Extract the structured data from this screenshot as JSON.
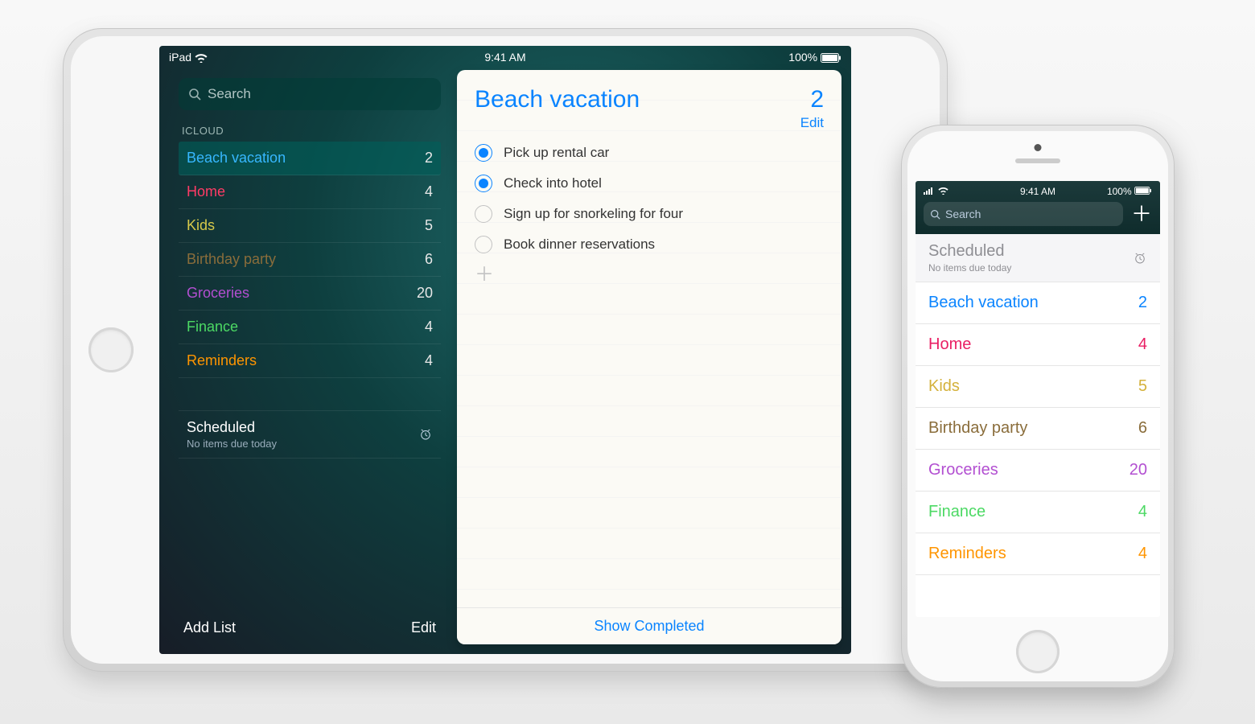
{
  "ipad": {
    "status": {
      "device": "iPad",
      "time": "9:41 AM",
      "battery": "100%"
    },
    "search": {
      "placeholder": "Search"
    },
    "section": "ICLOUD",
    "lists": [
      {
        "name": "Beach vacation",
        "count": "2",
        "color": "#37b7ff",
        "selected": true
      },
      {
        "name": "Home",
        "count": "4",
        "color": "#ff3b66"
      },
      {
        "name": "Kids",
        "count": "5",
        "color": "#d6c94a"
      },
      {
        "name": "Birthday party",
        "count": "6",
        "color": "#8a6d3b"
      },
      {
        "name": "Groceries",
        "count": "20",
        "color": "#b24fd1"
      },
      {
        "name": "Finance",
        "count": "4",
        "color": "#4cd964"
      },
      {
        "name": "Reminders",
        "count": "4",
        "color": "#ff9500"
      }
    ],
    "scheduled": {
      "title": "Scheduled",
      "sub": "No items due today"
    },
    "footer": {
      "add": "Add List",
      "edit": "Edit"
    },
    "detail": {
      "title": "Beach vacation",
      "count": "2",
      "edit": "Edit",
      "items": [
        {
          "text": "Pick up rental car",
          "checked": true
        },
        {
          "text": "Check into hotel",
          "checked": true
        },
        {
          "text": "Sign up for snorkeling for four",
          "checked": false
        },
        {
          "text": "Book dinner reservations",
          "checked": false
        }
      ],
      "showCompleted": "Show Completed"
    }
  },
  "iphone": {
    "status": {
      "time": "9:41 AM",
      "battery": "100%"
    },
    "search": {
      "placeholder": "Search"
    },
    "scheduled": {
      "title": "Scheduled",
      "sub": "No items due today"
    },
    "lists": [
      {
        "name": "Beach vacation",
        "count": "2",
        "color": "#0a84ff"
      },
      {
        "name": "Home",
        "count": "4",
        "color": "#e91e63"
      },
      {
        "name": "Kids",
        "count": "5",
        "color": "#d4b13b"
      },
      {
        "name": "Birthday party",
        "count": "6",
        "color": "#8a6d3b"
      },
      {
        "name": "Groceries",
        "count": "20",
        "color": "#b24fd1"
      },
      {
        "name": "Finance",
        "count": "4",
        "color": "#4cd964"
      },
      {
        "name": "Reminders",
        "count": "4",
        "color": "#ff9500"
      }
    ]
  }
}
